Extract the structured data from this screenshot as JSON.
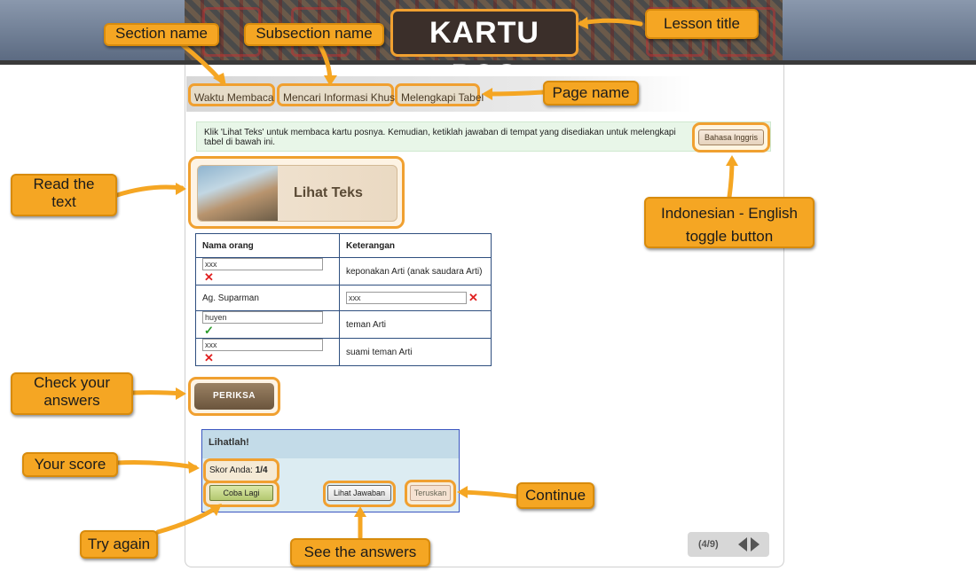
{
  "lesson_title": "KARTU POS",
  "breadcrumb": {
    "section": "Waktu Membaca",
    "subsection": "Mencari Informasi Khusus",
    "page": "Melengkapi Tabel"
  },
  "instruction": "Klik 'Lihat Teks' untuk membaca kartu posnya. Kemudian, ketiklah jawaban di tempat yang disediakan untuk melengkapi tabel di bawah ini.",
  "language_toggle_label": "Bahasa Inggris",
  "view_text_label": "Lihat Teks",
  "table": {
    "headers": [
      "Nama orang",
      "Keterangan"
    ],
    "rows": [
      {
        "name": "xxx",
        "name_is_input": true,
        "name_mark": "✕",
        "desc": "keponakan Arti (anak saudara Arti)"
      },
      {
        "name": "Ag. Suparman",
        "desc": "xxx",
        "desc_is_input": true,
        "desc_mark": "✕"
      },
      {
        "name": "huyen",
        "name_is_input": true,
        "name_mark": "✓",
        "desc": "teman Arti"
      },
      {
        "name": "xxx",
        "name_is_input": true,
        "name_mark": "✕",
        "desc": "suami teman Arti"
      }
    ]
  },
  "check_button_label": "PERIKSA",
  "feedback": {
    "title": "Lihatlah!",
    "score_label": "Skor Anda:",
    "score_value": "1/4",
    "try_again_label": "Coba Lagi",
    "show_answers_label": "Lihat Jawaban",
    "continue_label": "Teruskan"
  },
  "pager": {
    "text": "(4/9)"
  },
  "callouts": {
    "section_name": "Section name",
    "subsection_name": "Subsection name",
    "lesson_title": "Lesson title",
    "page_name": "Page name",
    "read_text_1": "Read the",
    "read_text_2": "text",
    "lang_toggle_1": "Indonesian - English",
    "lang_toggle_2": "toggle button",
    "check_answers_1": "Check your",
    "check_answers_2": "answers",
    "your_score": "Your score",
    "continue": "Continue",
    "try_again": "Try again",
    "see_answers": "See the answers"
  },
  "colors": {
    "callout": "#f5a623",
    "highlight": "#f0a030",
    "wrong": "#e02020",
    "correct": "#2a9a2a"
  }
}
